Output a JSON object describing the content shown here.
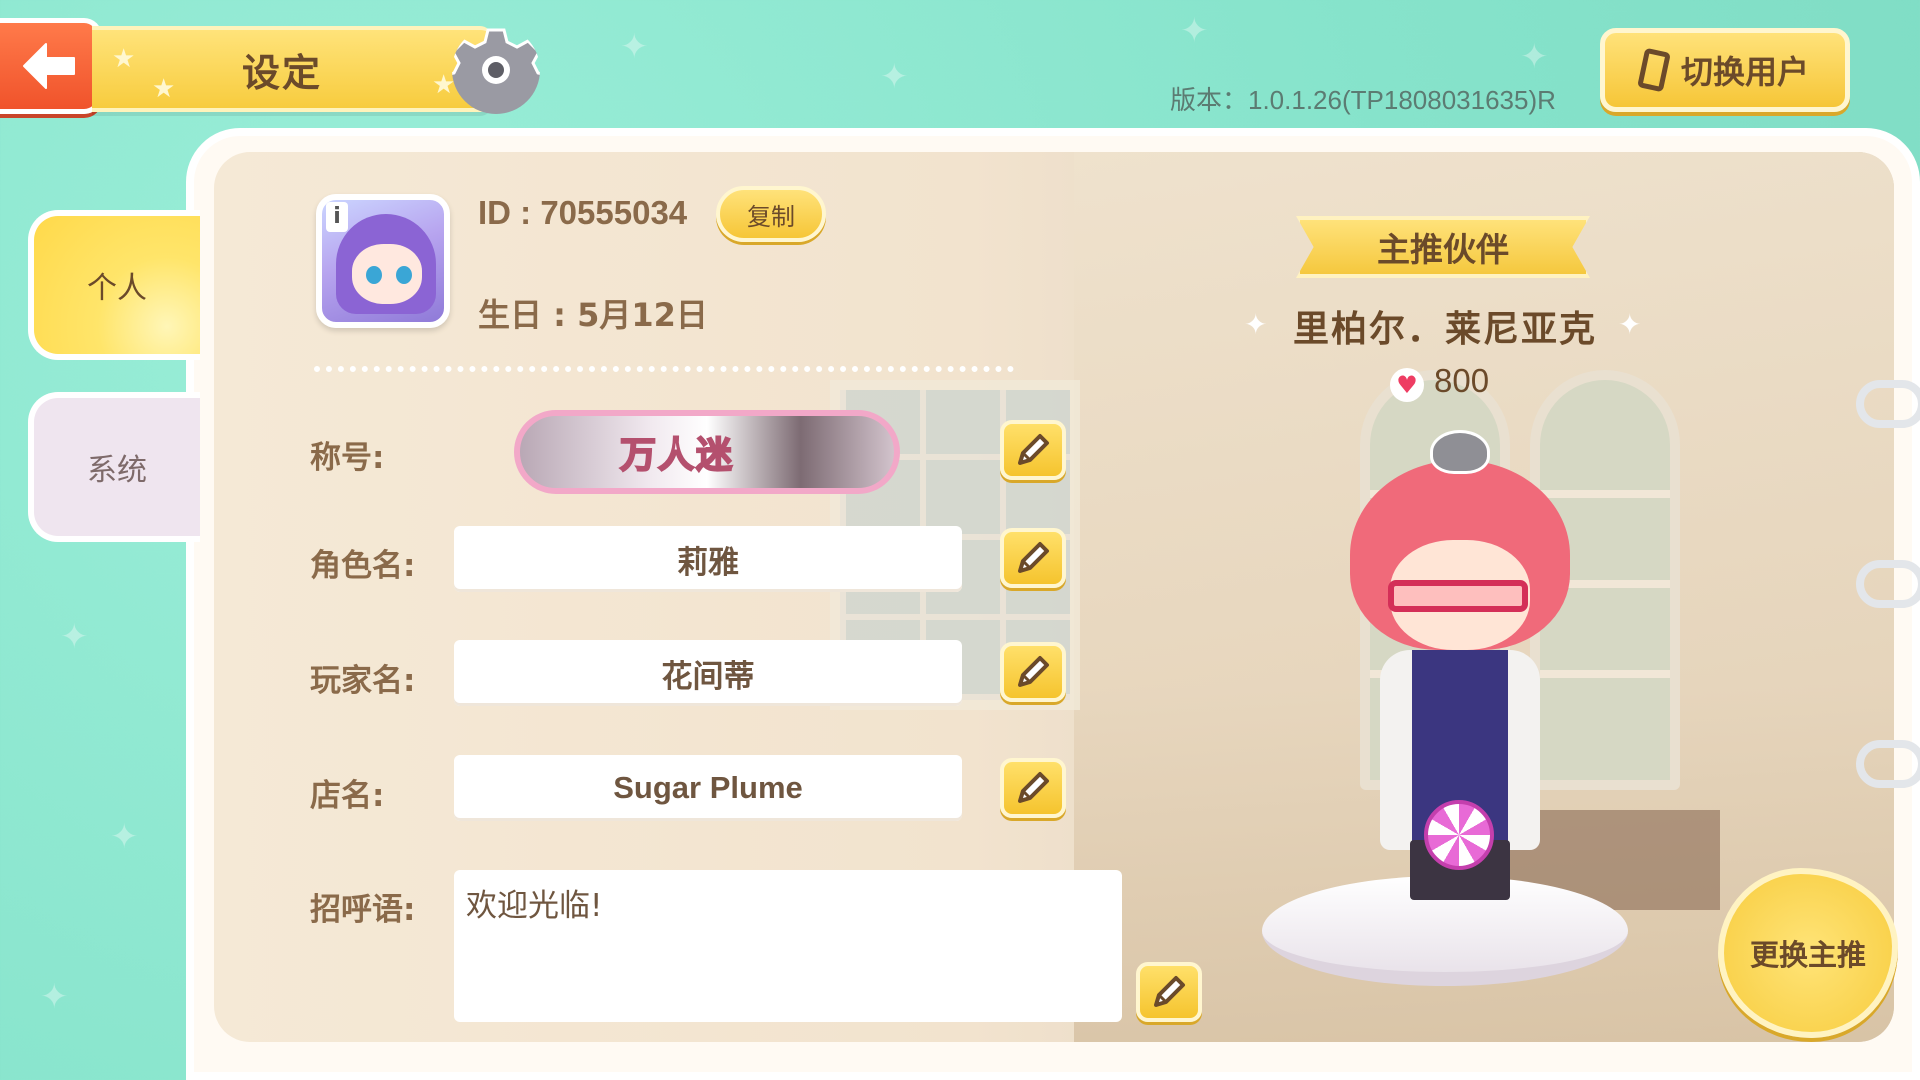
{
  "header": {
    "title": "设定",
    "version_text": "版本：1.0.1.26(TP1808031635)R",
    "switch_user_label": "切换用户"
  },
  "tabs": [
    {
      "label": "个人",
      "active": true
    },
    {
      "label": "系统",
      "active": false
    }
  ],
  "profile": {
    "id_text": "ID : 70555034",
    "copy_label": "复制",
    "birthday_text": "生日 : 5月12日"
  },
  "fields": {
    "title_label": "称号:",
    "title_badge": "万人迷",
    "role_label": "角色名:",
    "role_value": "莉雅",
    "player_label": "玩家名:",
    "player_value": "花间蒂",
    "shop_label": "店名:",
    "shop_value": "Sugar Plume",
    "greeting_label": "招呼语:",
    "greeting_value": "欢迎光临!"
  },
  "partner": {
    "ribbon_label": "主推伙伴",
    "name": "里柏尔．莱尼亚克",
    "affection": "800",
    "change_label": "更换主推"
  },
  "colors": {
    "background": "#86e3cb",
    "accent_yellow": "#f7cc3e",
    "back_button": "#f0532b",
    "text_brown": "#6b4a2a"
  }
}
